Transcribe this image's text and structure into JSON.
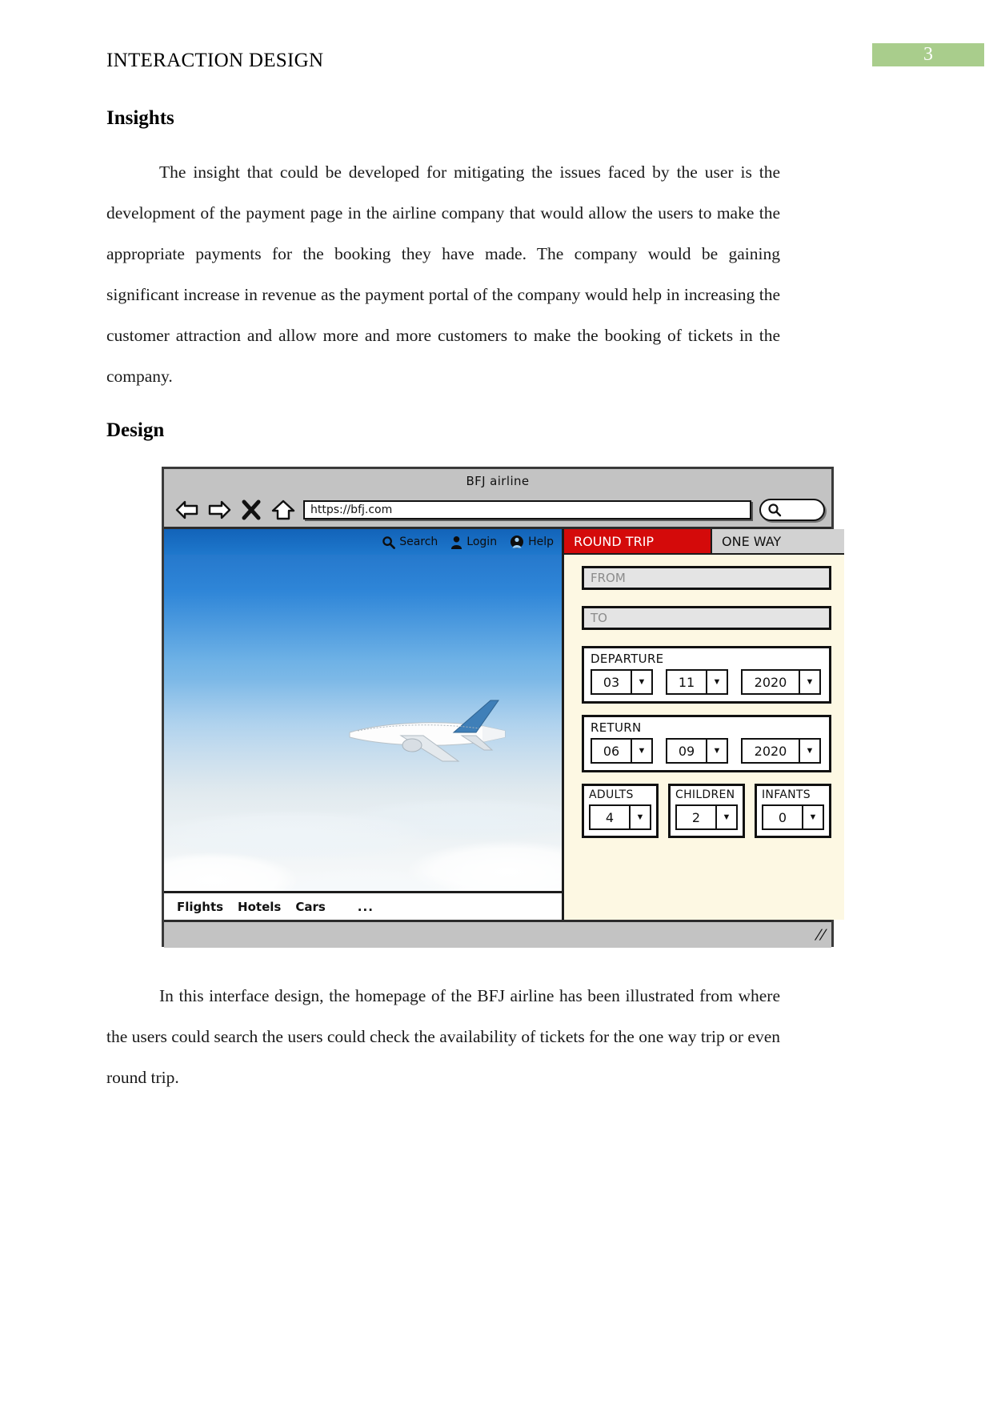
{
  "document": {
    "running_head": "INTERACTION DESIGN",
    "page_number": "3",
    "accent_badge_color": "#a9cd8c"
  },
  "sections": {
    "insights": {
      "heading": "Insights",
      "body": "The insight that could be developed for mitigating the issues faced by the user is the development of the payment page in the airline company that would allow the users to make the appropriate payments for the booking they have made. The company would be gaining significant increase in revenue as the payment portal of the company would help in increasing the customer attraction and allow more and more customers to make the booking of tickets in the company."
    },
    "design": {
      "heading": "Design",
      "caption": "In this interface design, the homepage of the BFJ airline has been illustrated from where the users could search the users could check the availability of tickets for the one way trip or even round trip."
    }
  },
  "browser": {
    "title": "BFJ airline",
    "url": "https://bfj.com",
    "nav_icons": [
      "back-arrow-icon",
      "forward-arrow-icon",
      "close-x-icon",
      "home-icon"
    ],
    "search_icon": "magnifier-icon",
    "resize_grip": "resize-grip-icon"
  },
  "site": {
    "top_nav": [
      {
        "label": "Search",
        "icon": "magnifier-icon"
      },
      {
        "label": "Login",
        "icon": "user-icon"
      },
      {
        "label": "Help",
        "icon": "help-person-icon"
      }
    ],
    "bottom_nav": {
      "items": [
        "Flights",
        "Hotels",
        "Cars"
      ],
      "overflow": "..."
    },
    "hero_image": "airplane-above-clouds-photo"
  },
  "booking": {
    "tabs": [
      {
        "label": "ROUND TRIP",
        "active": true,
        "color": "#d40a0a"
      },
      {
        "label": "ONE WAY",
        "active": false,
        "color": "#d2d2d2"
      }
    ],
    "from": {
      "label": "FROM",
      "value": ""
    },
    "to": {
      "label": "TO",
      "value": ""
    },
    "departure": {
      "label": "DEPARTURE",
      "day": "03",
      "month": "11",
      "year": "2020"
    },
    "return": {
      "label": "RETURN",
      "day": "06",
      "month": "09",
      "year": "2020"
    },
    "passengers": [
      {
        "label": "ADULTS",
        "value": "4"
      },
      {
        "label": "CHILDREN",
        "value": "2"
      },
      {
        "label": "INFANTS",
        "value": "0"
      }
    ],
    "caret_glyph": "▼"
  }
}
